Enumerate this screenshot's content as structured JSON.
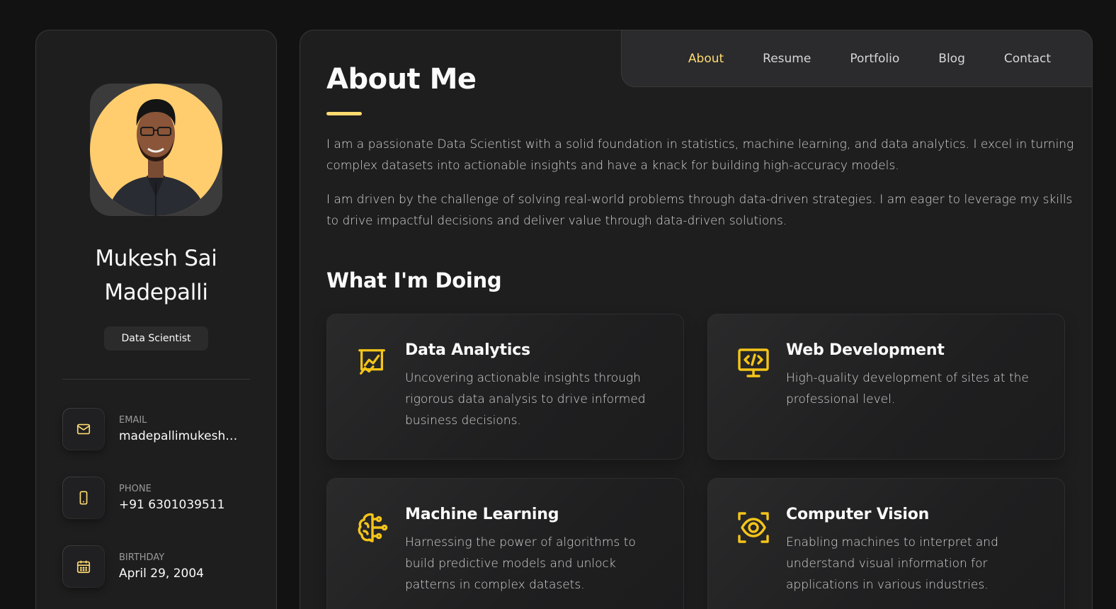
{
  "sidebar": {
    "name_line1": "Mukesh Sai",
    "name_line2": "Madepalli",
    "title": "Data Scientist",
    "contacts": [
      {
        "label": "EMAIL",
        "value": "madepallimukesh@...",
        "icon": "mail-icon"
      },
      {
        "label": "PHONE",
        "value": "+91 6301039511",
        "icon": "phone-icon"
      },
      {
        "label": "BIRTHDAY",
        "value": "April 29, 2004",
        "icon": "calendar-icon"
      }
    ]
  },
  "nav": {
    "items": [
      "About",
      "Resume",
      "Portfolio",
      "Blog",
      "Contact"
    ],
    "active": "About"
  },
  "about": {
    "heading": "About Me",
    "para1": "I am a passionate Data Scientist with a solid foundation in statistics, machine learning, and data analytics. I excel in turning complex datasets into actionable insights and have a knack for building high-accuracy models.",
    "para2": "I am driven by the challenge of solving real-world problems through data-driven strategies. I am eager to leverage my skills to drive impactful decisions and deliver value through data-driven solutions."
  },
  "doing": {
    "heading": "What I'm Doing",
    "cards": [
      {
        "title": "Data Analytics",
        "text": "Uncovering actionable insights through rigorous data analysis to drive informed business decisions.",
        "icon": "chart-board-icon"
      },
      {
        "title": "Web Development",
        "text": "High-quality development of sites at the professional level.",
        "icon": "code-monitor-icon"
      },
      {
        "title": "Machine Learning",
        "text": "Harnessing the power of algorithms to build predictive models and unlock patterns in complex datasets.",
        "icon": "brain-circuit-icon"
      },
      {
        "title": "Computer Vision",
        "text": "Enabling machines to interpret and understand visual information for applications in various industries.",
        "icon": "eye-scan-icon"
      }
    ]
  },
  "colors": {
    "accent": "#ffdb70",
    "icon_yellow": "#f5c518",
    "avatar_bg": "#ffcd6e",
    "background": "#121212",
    "panel": "#1e1e1f"
  }
}
